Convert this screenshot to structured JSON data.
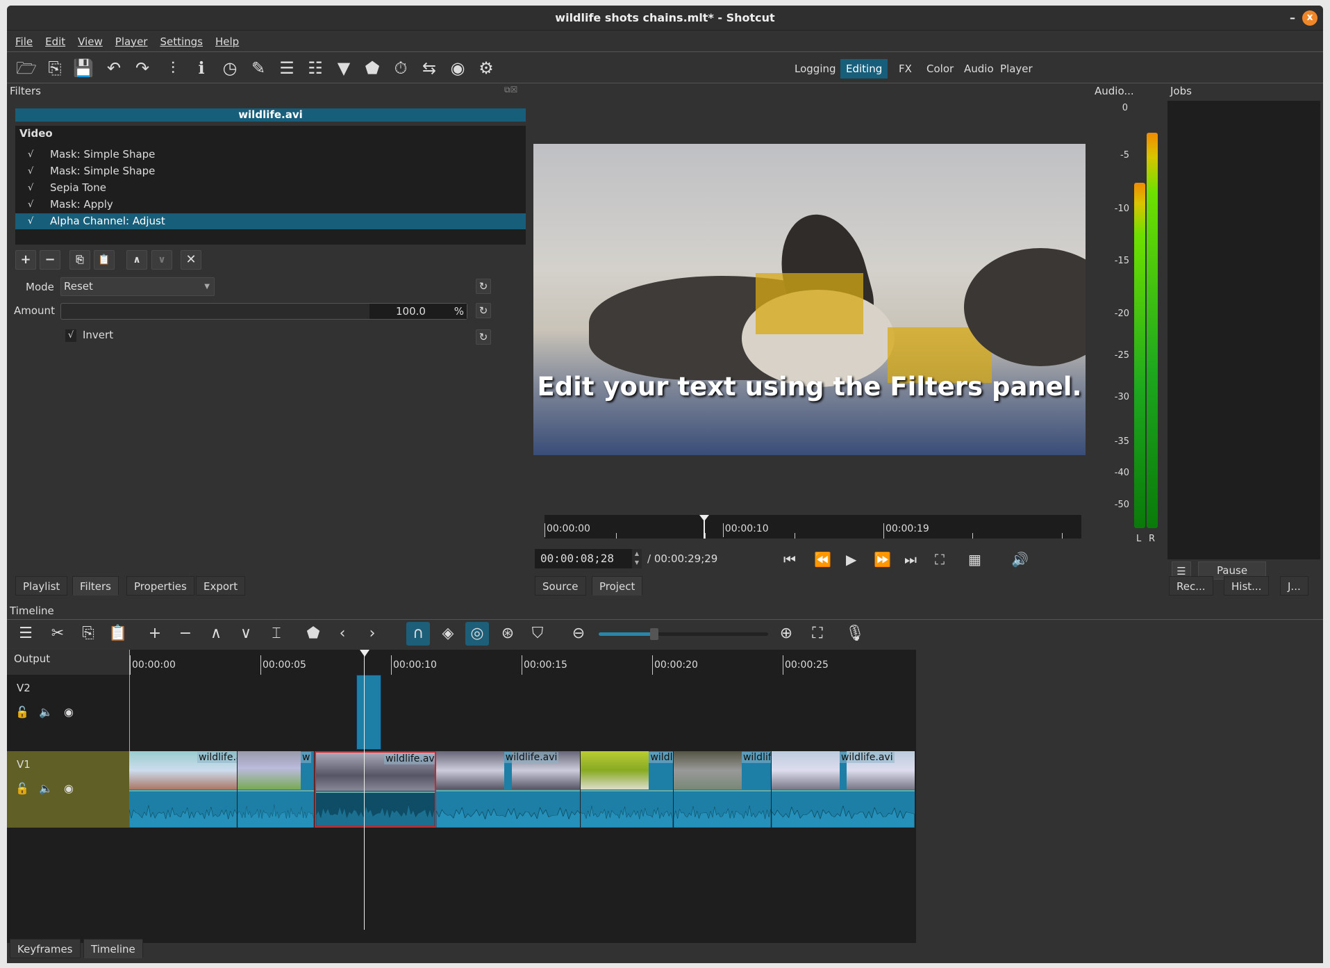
{
  "window": {
    "title": "wildlife shots chains.mlt* - Shotcut",
    "minimize": "–",
    "close": "x"
  },
  "menu": [
    "File",
    "Edit",
    "View",
    "Player",
    "Settings",
    "Help"
  ],
  "toolbar": {
    "icons": [
      "open-icon",
      "open-other-icon",
      "save-icon",
      "undo-icon",
      "redo-icon",
      "peak-meter-icon",
      "properties-icon",
      "history-icon",
      "notes-icon",
      "playlist-icon",
      "timeline-icon",
      "filters-icon",
      "markers-icon",
      "keyframes-icon",
      "export-icon",
      "jobs-icon",
      "settings-icon"
    ],
    "layouts": [
      {
        "label": "Logging",
        "active": false
      },
      {
        "label": "Editing",
        "active": true
      },
      {
        "label": "FX",
        "active": false
      },
      {
        "label": "Color",
        "active": false
      },
      {
        "label": "Audio",
        "active": false
      },
      {
        "label": "Player",
        "active": false
      }
    ]
  },
  "filters": {
    "title": "Filters",
    "clip": "wildlife.avi",
    "section": "Video",
    "items": [
      {
        "label": "Mask: Simple Shape",
        "checked": true
      },
      {
        "label": "Mask: Simple Shape",
        "checked": true
      },
      {
        "label": "Sepia Tone",
        "checked": true
      },
      {
        "label": "Mask: Apply",
        "checked": true
      },
      {
        "label": "Alpha Channel: Adjust",
        "checked": true,
        "selected": true
      }
    ],
    "mode_label": "Mode",
    "mode_value": "Reset",
    "amount_label": "Amount",
    "amount_value": "100.0",
    "amount_unit": "%",
    "amount_percent": 100,
    "invert_label": "Invert",
    "invert_checked": true,
    "check": "√"
  },
  "left_tabs": [
    {
      "label": "Playlist"
    },
    {
      "label": "Filters",
      "active": true
    },
    {
      "label": "Properties"
    },
    {
      "label": "Export"
    }
  ],
  "player": {
    "overlay_text": "Edit your text using the Filters panel.",
    "ruler": [
      "00:00:00",
      "00:00:10",
      "00:00:19"
    ],
    "position": "00:00:08;28",
    "duration": "/ 00:00:29;29",
    "position_seconds": 8.93,
    "duration_seconds": 29.97,
    "tabs": [
      {
        "label": "Source"
      },
      {
        "label": "Project",
        "active": true
      }
    ]
  },
  "audio": {
    "title": "Audio...",
    "scale": [
      "0",
      "-5",
      "-10",
      "-15",
      "-20",
      "-25",
      "-30",
      "-35",
      "-40",
      "-50"
    ],
    "left_label": "L",
    "right_label": "R",
    "left_db": -7,
    "right_db": -2
  },
  "jobs": {
    "title": "Jobs",
    "pause": "Pause",
    "tabs": [
      "Rec...",
      "Hist...",
      "J..."
    ]
  },
  "timeline": {
    "title": "Timeline",
    "output": "Output",
    "ruler": [
      "00:00:00",
      "00:00:05",
      "00:00:10",
      "00:00:15",
      "00:00:20",
      "00:00:25"
    ],
    "playhead_seconds": 9.0,
    "tracks": [
      {
        "name": "V2"
      },
      {
        "name": "V1"
      }
    ],
    "v2_clip": {
      "start": 8.7,
      "end": 9.65
    },
    "v1_clips": [
      {
        "label": "wildlife.a",
        "start": 0,
        "end": 4.15
      },
      {
        "label": "w",
        "start": 4.15,
        "end": 7.1
      },
      {
        "label": "wildlife.avi",
        "start": 7.1,
        "end": 11.75,
        "selected": true
      },
      {
        "label": "wildlife.avi",
        "start": 11.75,
        "end": 17.3
      },
      {
        "label": "wildli",
        "start": 17.3,
        "end": 20.85
      },
      {
        "label": "wildlife",
        "start": 20.85,
        "end": 24.6
      },
      {
        "label": "wildlife.avi",
        "start": 24.6,
        "end": 30.1
      }
    ]
  },
  "bottom_tabs": [
    {
      "label": "Keyframes"
    },
    {
      "label": "Timeline",
      "active": true
    }
  ],
  "colors": {
    "accent": "#175e7a",
    "clip": "#1d7fa6",
    "selected_clip_border": "#e02020",
    "v1_header": "#5f5f26",
    "close_button": "#f0862a"
  }
}
